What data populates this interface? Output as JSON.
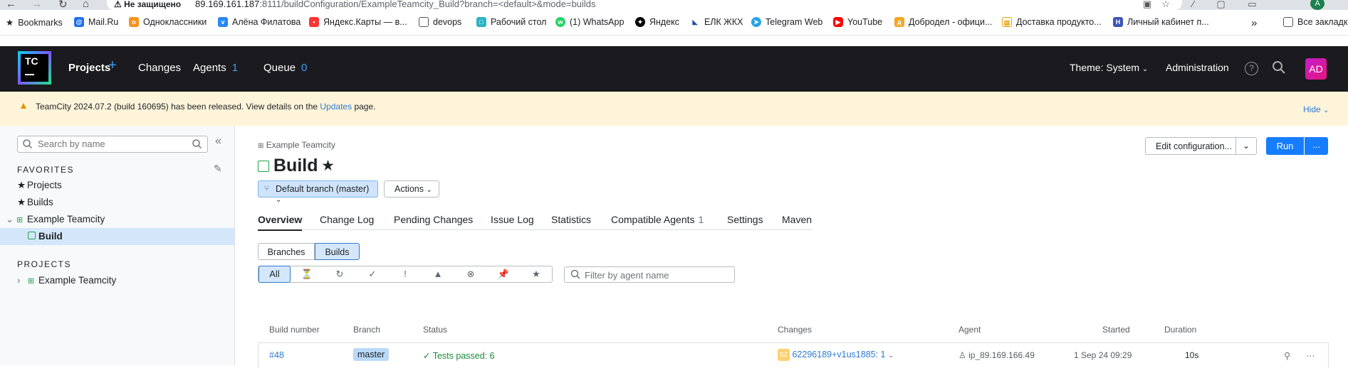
{
  "browser": {
    "security": "Не защищено",
    "url_host": "89.169.161.187",
    "url_rest": ":8111/buildConfiguration/ExampleTeamcity_Build?branch=<default>&mode=builds",
    "profile": "A",
    "bookmarks": [
      {
        "label": "Bookmarks",
        "icon": "star-icon"
      },
      {
        "label": "Mail.Ru",
        "icon": "mail-icon"
      },
      {
        "label": "Одноклассники",
        "icon": "ok-icon"
      },
      {
        "label": "Алёна Филатова",
        "icon": "vk-icon"
      },
      {
        "label": "Яндекс.Карты — в...",
        "icon": "map-pin-icon"
      },
      {
        "label": "devops",
        "icon": "folder-icon"
      },
      {
        "label": "Рабочий стол",
        "icon": "desktop-icon"
      },
      {
        "label": "(1) WhatsApp",
        "icon": "whatsapp-icon"
      },
      {
        "label": "Яндекс",
        "icon": "yandex-icon"
      },
      {
        "label": "ЕЛК ЖКХ",
        "icon": "elk-icon"
      },
      {
        "label": "Telegram Web",
        "icon": "telegram-icon"
      },
      {
        "label": "YouTube",
        "icon": "youtube-icon"
      },
      {
        "label": "Добродел - офици...",
        "icon": "dobrodel-icon"
      },
      {
        "label": "Доставка продукто...",
        "icon": "delivery-icon"
      },
      {
        "label": "Личный кабинет п...",
        "icon": "cabinet-icon"
      }
    ],
    "more": "»",
    "all_bookmarks": "Все закладк"
  },
  "header": {
    "logo": "TC",
    "projects": "Projects",
    "changes": "Changes",
    "agents": "Agents",
    "agents_count": "1",
    "queue": "Queue",
    "queue_count": "0",
    "theme": "Theme: System",
    "administration": "Administration",
    "help": "?",
    "avatar": "AD"
  },
  "banner": {
    "text_before": "TeamCity 2024.07.2 (build 160695) has been released. View details on the",
    "link": "Updates",
    "text_after": "page.",
    "hide": "Hide"
  },
  "sidebar": {
    "search_placeholder": "Search by name",
    "favorites_header": "FAVORITES",
    "favorites": [
      "Projects",
      "Builds"
    ],
    "tree_project": "Example Teamcity",
    "tree_build": "Build",
    "projects_header": "PROJECTS",
    "projects": [
      "Example Teamcity"
    ]
  },
  "main": {
    "breadcrumb": "Example Teamcity",
    "title": "Build",
    "branch": "Default branch (master)",
    "actions": "Actions",
    "edit": "Edit configuration...",
    "run": "Run",
    "run_more": "...",
    "tabs": [
      {
        "label": "Overview",
        "count": ""
      },
      {
        "label": "Change Log",
        "count": ""
      },
      {
        "label": "Pending Changes",
        "count": ""
      },
      {
        "label": "Issue Log",
        "count": ""
      },
      {
        "label": "Statistics",
        "count": ""
      },
      {
        "label": "Compatible Agents",
        "count": "1"
      },
      {
        "label": "Settings",
        "count": ""
      },
      {
        "label": "Maven",
        "count": ""
      }
    ],
    "view_toggle": [
      "Branches",
      "Builds"
    ],
    "filter_all": "All",
    "agent_filter_placeholder": "Filter by agent name"
  },
  "table": {
    "columns": [
      "Build number",
      "Branch",
      "Status",
      "Changes",
      "Agent",
      "Started",
      "Duration"
    ],
    "rows": [
      {
        "number": "#48",
        "branch": "master",
        "status": "Tests passed: 6",
        "change_avatar": "SZ",
        "changes": "62296189+v1us1885: 1",
        "agent": "ip_89.169.166.49",
        "started": "1 Sep 24 09:29",
        "duration": "10s"
      }
    ]
  },
  "colors": {
    "accent": "#167dff",
    "header_bg": "#1b1b1f",
    "banner_bg": "#fdf4da",
    "success": "#1b8a3c"
  }
}
